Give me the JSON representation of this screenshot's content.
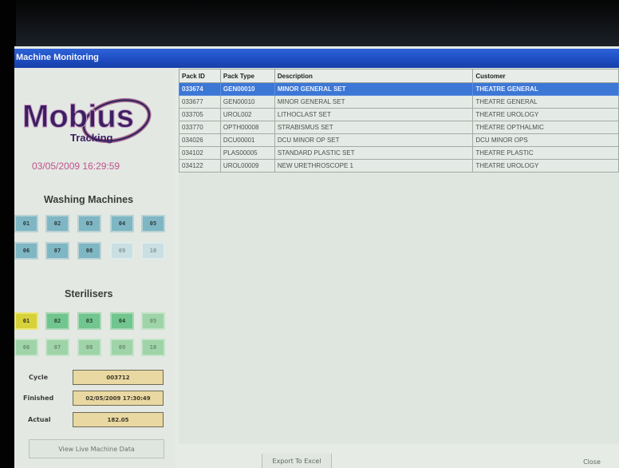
{
  "window": {
    "title": "Machine Monitoring"
  },
  "logo": {
    "word": "Mobius",
    "subword": "Tracking"
  },
  "datetime": "03/05/2009 16:29:59",
  "washing": {
    "title": "Washing Machines",
    "buttons": [
      "01",
      "02",
      "03",
      "04",
      "05",
      "06",
      "07",
      "08",
      "09",
      "10"
    ]
  },
  "sterilisers": {
    "title": "Sterilisers",
    "buttons": [
      "01",
      "02",
      "03",
      "04",
      "05",
      "06",
      "07",
      "08",
      "09",
      "10"
    ]
  },
  "cycle": {
    "label": "Cycle",
    "value": "003712"
  },
  "finished": {
    "label": "Finished",
    "value": "02/05/2009 17:30:49"
  },
  "actual": {
    "label": "Actual",
    "value": "182.05"
  },
  "buttons": {
    "view_live": "View Live Machine Data",
    "export": "Export To Excel",
    "close": "Close"
  },
  "table": {
    "headers": [
      "Pack ID",
      "Pack Type",
      "Description",
      "Customer"
    ],
    "rows": [
      [
        "033674",
        "GEN00010",
        "MINOR GENERAL SET",
        "THEATRE GENERAL"
      ],
      [
        "033677",
        "GEN00010",
        "MINOR GENERAL SET",
        "THEATRE GENERAL"
      ],
      [
        "033705",
        "UROL002",
        "LITHOCLAST SET",
        "THEATRE UROLOGY"
      ],
      [
        "033770",
        "OPTH00008",
        "STRABISMUS SET",
        "THEATRE OPTHALMIC"
      ],
      [
        "034026",
        "DCU00001",
        "DCU MINOR OP SET",
        "DCU MINOR OPS"
      ],
      [
        "034102",
        "PLAS00005",
        "STANDARD PLASTIC SET",
        "THEATRE PLASTIC"
      ],
      [
        "034122",
        "UROL00009",
        "NEW URETHROSCOPE 1",
        "THEATRE UROLOGY"
      ]
    ],
    "selected_row": 0
  },
  "colors": {
    "titlebar": "#1f4fc4",
    "washing_button": "#7fb6c4",
    "steriliser_active": "#71c58f",
    "steriliser_running": "#d8d23a",
    "datetime": "#c0528c",
    "value_box": "#e9d8a2"
  }
}
